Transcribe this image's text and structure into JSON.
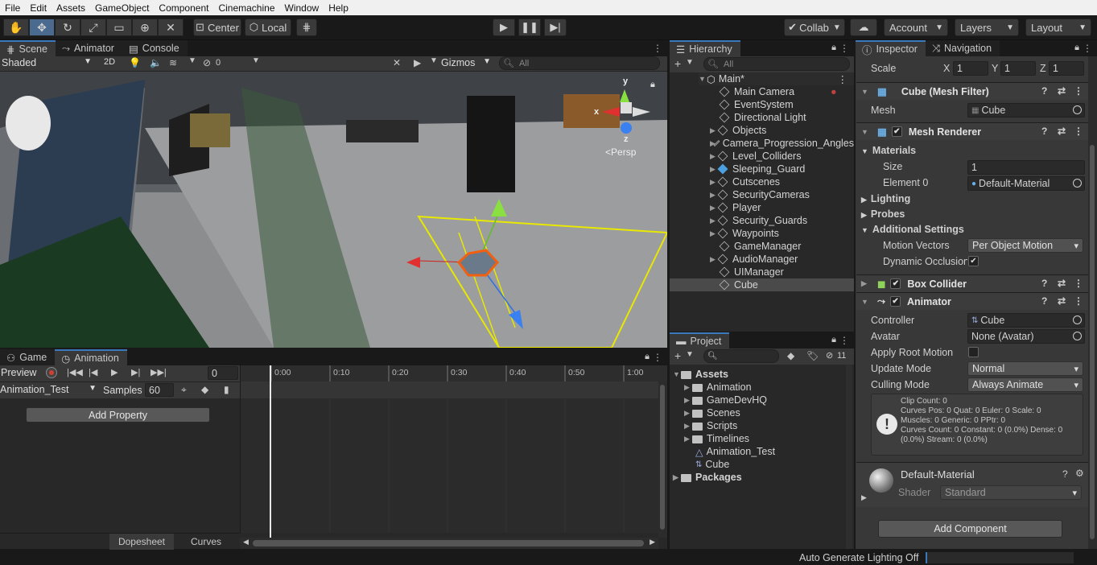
{
  "menu": [
    "File",
    "Edit",
    "Assets",
    "GameObject",
    "Component",
    "Cinemachine",
    "Window",
    "Help"
  ],
  "toolbar": {
    "pivot": "Center",
    "space": "Local",
    "collab": "Collab",
    "account": "Account",
    "layers": "Layers",
    "layout": "Layout"
  },
  "scene": {
    "tabs": [
      "Scene",
      "Animator",
      "Console"
    ],
    "shading": "Shaded",
    "mode2d": "2D",
    "hidden_count": "0",
    "gizmos": "Gizmos",
    "search_placeholder": "All",
    "persp": "Persp",
    "axis_x": "x",
    "axis_y": "y",
    "axis_z": "z"
  },
  "hierarchy": {
    "title": "Hierarchy",
    "search_placeholder": "All",
    "root": "Main*",
    "items": [
      "Main Camera",
      "EventSystem",
      "Directional Light",
      "Objects",
      "Camera_Progression_Angles",
      "Level_Colliders",
      "Sleeping_Guard",
      "Cutscenes",
      "SecurityCameras",
      "Player",
      "Security_Guards",
      "Waypoints",
      "GameManager",
      "AudioManager",
      "UIManager",
      "Cube"
    ]
  },
  "project": {
    "title": "Project",
    "hidden_count": "11",
    "root": "Assets",
    "folders": [
      "Animation",
      "GameDevHQ",
      "Scenes",
      "Scripts",
      "Timelines"
    ],
    "files": [
      "Animation_Test",
      "Cube"
    ],
    "packages": "Packages"
  },
  "animation": {
    "tabs": [
      "Game",
      "Animation"
    ],
    "preview": "Preview",
    "frame": "0",
    "clip": "Animation_Test",
    "samples_label": "Samples",
    "samples": "60",
    "add_property": "Add Property",
    "ticks": [
      "0:00",
      "0:10",
      "0:20",
      "0:30",
      "0:40",
      "0:50",
      "1:00"
    ],
    "bottom_tabs": [
      "Dopesheet",
      "Curves"
    ]
  },
  "inspector": {
    "tabs": [
      "Inspector",
      "Navigation"
    ],
    "scale": {
      "label": "Scale",
      "x_label": "X",
      "x": "1",
      "y_label": "Y",
      "y": "1",
      "z_label": "Z",
      "z": "1"
    },
    "mesh_filter": {
      "title": "Cube (Mesh Filter)",
      "mesh_label": "Mesh",
      "mesh": "Cube"
    },
    "mesh_renderer": {
      "title": "Mesh Renderer",
      "materials": "Materials",
      "size_label": "Size",
      "size": "1",
      "element0_label": "Element 0",
      "element0": "Default-Material",
      "lighting": "Lighting",
      "probes": "Probes",
      "additional": "Additional Settings",
      "motion_label": "Motion Vectors",
      "motion": "Per Object Motion",
      "dynamic_label": "Dynamic Occlusion"
    },
    "box_collider": {
      "title": "Box Collider"
    },
    "animator": {
      "title": "Animator",
      "controller_label": "Controller",
      "controller": "Cube",
      "avatar_label": "Avatar",
      "avatar": "None (Avatar)",
      "root_motion_label": "Apply Root Motion",
      "update_label": "Update Mode",
      "update": "Normal",
      "culling_label": "Culling Mode",
      "culling": "Always Animate",
      "info": [
        "Clip Count: 0",
        "Curves Pos: 0 Quat: 0 Euler: 0 Scale: 0",
        "Muscles: 0 Generic: 0 PPtr: 0",
        "Curves Count: 0 Constant: 0 (0.0%) Dense: 0",
        "(0.0%) Stream: 0 (0.0%)"
      ]
    },
    "material": {
      "name": "Default-Material",
      "shader_label": "Shader",
      "shader": "Standard"
    },
    "add_component": "Add Component"
  },
  "status": "Auto Generate Lighting Off"
}
